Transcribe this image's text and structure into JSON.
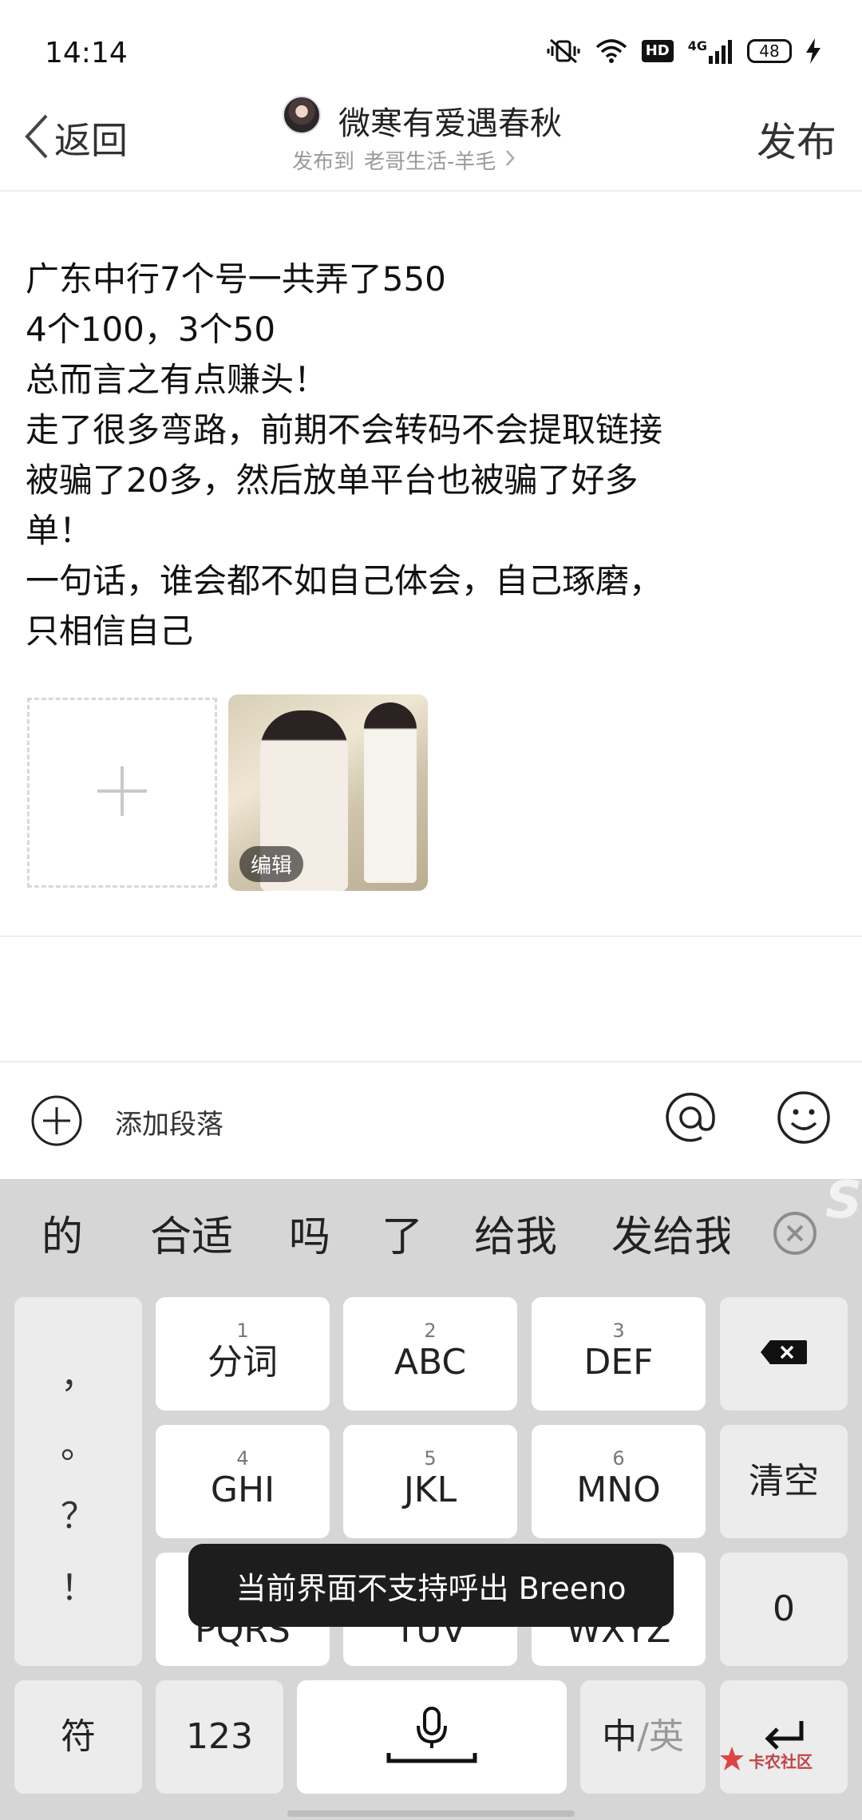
{
  "status_bar": {
    "time": "14:14",
    "network": "4G",
    "hd_label": "HD",
    "battery_level": "48",
    "icons": [
      "mute-vibrate-icon",
      "wifi-icon",
      "hd-icon",
      "signal-icon",
      "battery-icon",
      "charging-icon"
    ]
  },
  "header": {
    "back_label": "返回",
    "author_name": "微寒有爱遇春秋",
    "publish_to_prefix": "发布到",
    "publish_to_target": "老哥生活-羊毛",
    "publish_label": "发布"
  },
  "post": {
    "lines": [
      "广东中行7个号一共弄了550",
      "4个100，3个50",
      "总而言之有点赚头！",
      "走了很多弯路，前期不会转码不会提取链接",
      "被骗了20多，然后放单平台也被骗了好多",
      "单！",
      "一句话，谁会都不如自己体会，自己琢磨，",
      "只相信自己"
    ],
    "image_edit_label": "编辑"
  },
  "toolbar": {
    "add_paragraph_label": "添加段落"
  },
  "keyboard": {
    "candidates": [
      "的",
      "合适",
      "吗",
      "了",
      "给我",
      "发给我"
    ],
    "punctuation": [
      "，",
      "。",
      "？",
      "！"
    ],
    "keys": {
      "k1": {
        "digit": "1",
        "label": "分词"
      },
      "k2": {
        "digit": "2",
        "label": "ABC"
      },
      "k3": {
        "digit": "3",
        "label": "DEF"
      },
      "k4": {
        "digit": "4",
        "label": "GHI"
      },
      "k5": {
        "digit": "5",
        "label": "JKL"
      },
      "k6": {
        "digit": "6",
        "label": "MNO"
      },
      "k7": {
        "label": "PQRS"
      },
      "k8": {
        "label": "TUV"
      },
      "k9": {
        "label": "WXYZ"
      },
      "clear": "清空",
      "zero": "0",
      "symbols": "符",
      "numbers": "123",
      "lang_zh": "中",
      "lang_sep": "/",
      "lang_en": "英"
    }
  },
  "toast": {
    "message": "当前界面不支持呼出 Breeno"
  },
  "watermark": {
    "text": "卡农社区"
  }
}
